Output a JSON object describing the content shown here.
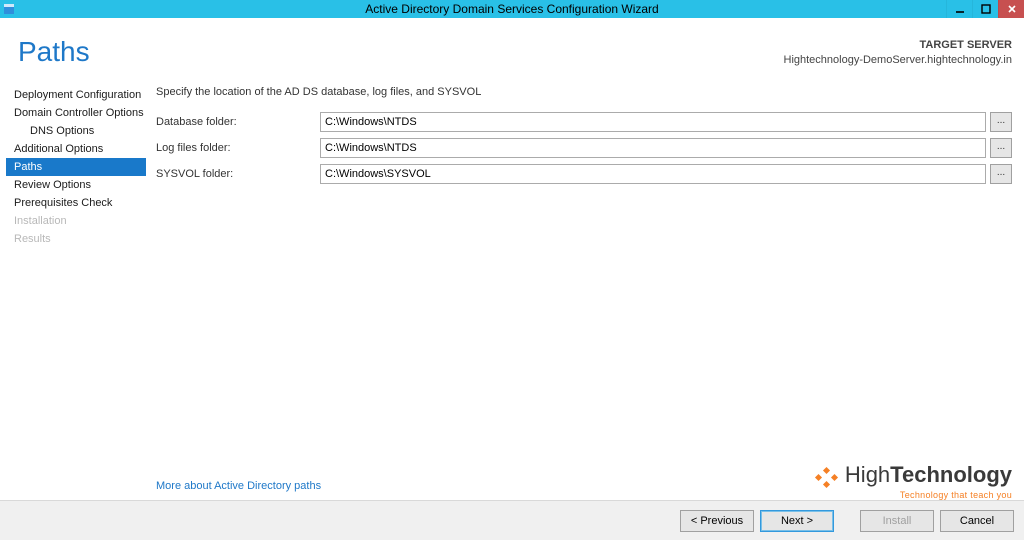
{
  "window": {
    "title": "Active Directory Domain Services Configuration Wizard"
  },
  "header": {
    "page_title": "Paths",
    "target_label": "TARGET SERVER",
    "target_value": "Hightechnology-DemoServer.hightechnology.in"
  },
  "sidebar": {
    "items": [
      {
        "label": "Deployment Configuration",
        "selected": false,
        "disabled": false,
        "indent": false
      },
      {
        "label": "Domain Controller Options",
        "selected": false,
        "disabled": false,
        "indent": false
      },
      {
        "label": "DNS Options",
        "selected": false,
        "disabled": false,
        "indent": true
      },
      {
        "label": "Additional Options",
        "selected": false,
        "disabled": false,
        "indent": false
      },
      {
        "label": "Paths",
        "selected": true,
        "disabled": false,
        "indent": false
      },
      {
        "label": "Review Options",
        "selected": false,
        "disabled": false,
        "indent": false
      },
      {
        "label": "Prerequisites Check",
        "selected": false,
        "disabled": false,
        "indent": false
      },
      {
        "label": "Installation",
        "selected": false,
        "disabled": true,
        "indent": false
      },
      {
        "label": "Results",
        "selected": false,
        "disabled": true,
        "indent": false
      }
    ]
  },
  "main": {
    "instruction": "Specify the location of the AD DS database, log files, and SYSVOL",
    "fields": [
      {
        "label": "Database folder:",
        "value": "C:\\Windows\\NTDS",
        "browse": "..."
      },
      {
        "label": "Log files folder:",
        "value": "C:\\Windows\\NTDS",
        "browse": "..."
      },
      {
        "label": "SYSVOL folder:",
        "value": "C:\\Windows\\SYSVOL",
        "browse": "..."
      }
    ],
    "more_link": "More about Active Directory paths"
  },
  "brand": {
    "name_prefix": "High",
    "name_suffix": "Technology",
    "tagline": "Technology that teach you"
  },
  "footer": {
    "previous": "< Previous",
    "next": "Next >",
    "install": "Install",
    "cancel": "Cancel"
  }
}
